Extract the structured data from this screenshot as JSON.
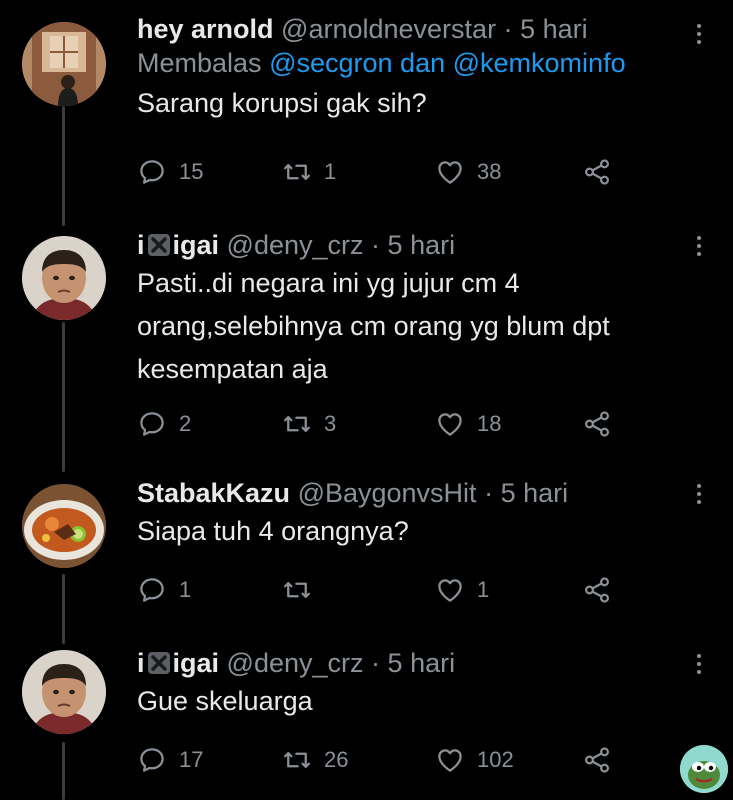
{
  "tweets": [
    {
      "name": "hey arnold",
      "handle": "@arnoldneverstar",
      "dot": "·",
      "time": "5 hari",
      "reply_prefix": "Membalas",
      "mention1": "@secgron",
      "reply_and": "dan",
      "mention2": "@kemkominfo",
      "text": "Sarang korupsi gak sih?",
      "replies": "15",
      "retweets": "1",
      "likes": "38"
    },
    {
      "name_a": "i",
      "name_b": "igai",
      "handle": "@deny_crz",
      "dot": "·",
      "time": "5 hari",
      "text_lines": [
        "Pasti..di negara ini yg jujur cm 4",
        "orang,selebihnya cm orang yg blum dpt",
        "kesempatan aja"
      ],
      "replies": "2",
      "retweets": "3",
      "likes": "18"
    },
    {
      "name": "StabakKazu",
      "handle": "@BaygonvsHit",
      "dot": "·",
      "time": "5 hari",
      "text": "Siapa tuh 4 orangnya?",
      "replies": "1",
      "retweets": "",
      "likes": "1"
    },
    {
      "name_a": "i",
      "name_b": "igai",
      "handle": "@deny_crz",
      "dot": "·",
      "time": "5 hari",
      "text": "Gue skeluarga",
      "replies": "17",
      "retweets": "26",
      "likes": "102"
    }
  ],
  "icons": {
    "reply": "comment-icon",
    "retweet": "retweet-icon",
    "like": "heart-icon",
    "share": "share-icon",
    "more": "more-vertical-icon"
  },
  "colors": {
    "background": "#000000",
    "text": "#e7e9ea",
    "muted": "#8b9196",
    "mention": "#1d9bf0"
  }
}
